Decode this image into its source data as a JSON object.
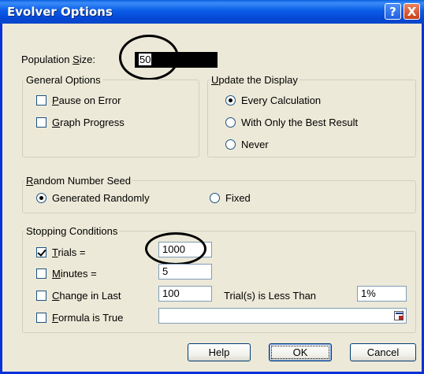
{
  "window": {
    "title": "Evolver Options"
  },
  "titlebar": {
    "help_glyph": "?",
    "close_glyph": "X"
  },
  "population": {
    "label_pre": "Population ",
    "label_key": "S",
    "label_post": "ize:",
    "value": "50"
  },
  "general_options": {
    "legend": "General Options",
    "pause_on_error": {
      "key": "P",
      "rest": "ause on Error",
      "checked": false
    },
    "graph_progress": {
      "key": "G",
      "rest": "raph Progress",
      "checked": false
    }
  },
  "update_display": {
    "legend_key": "U",
    "legend_rest": "pdate the Display",
    "options": [
      {
        "label": "Every Calculation",
        "selected": true
      },
      {
        "label": "With Only the Best Result",
        "selected": false
      },
      {
        "label": "Never",
        "selected": false
      }
    ]
  },
  "random_seed": {
    "legend_key": "R",
    "legend_rest": "andom Number Seed",
    "generated": {
      "label": "Generated Randomly",
      "selected": true
    },
    "fixed": {
      "label": "Fixed",
      "selected": false
    }
  },
  "stopping": {
    "legend": "Stopping Conditions",
    "trials": {
      "key": "T",
      "rest": "rials =",
      "checked": true,
      "value": "1000"
    },
    "minutes": {
      "key": "M",
      "rest": "inutes =",
      "checked": false,
      "value": "5"
    },
    "change": {
      "key": "C",
      "rest": "hange in Last",
      "checked": false,
      "value": "100",
      "mid_label": "Trial(s) is Less Than",
      "percent": "1%"
    },
    "formula": {
      "key": "F",
      "rest": "ormula is True",
      "checked": false,
      "value": ""
    }
  },
  "buttons": {
    "help": "Help",
    "ok": "OK",
    "cancel": "Cancel"
  }
}
